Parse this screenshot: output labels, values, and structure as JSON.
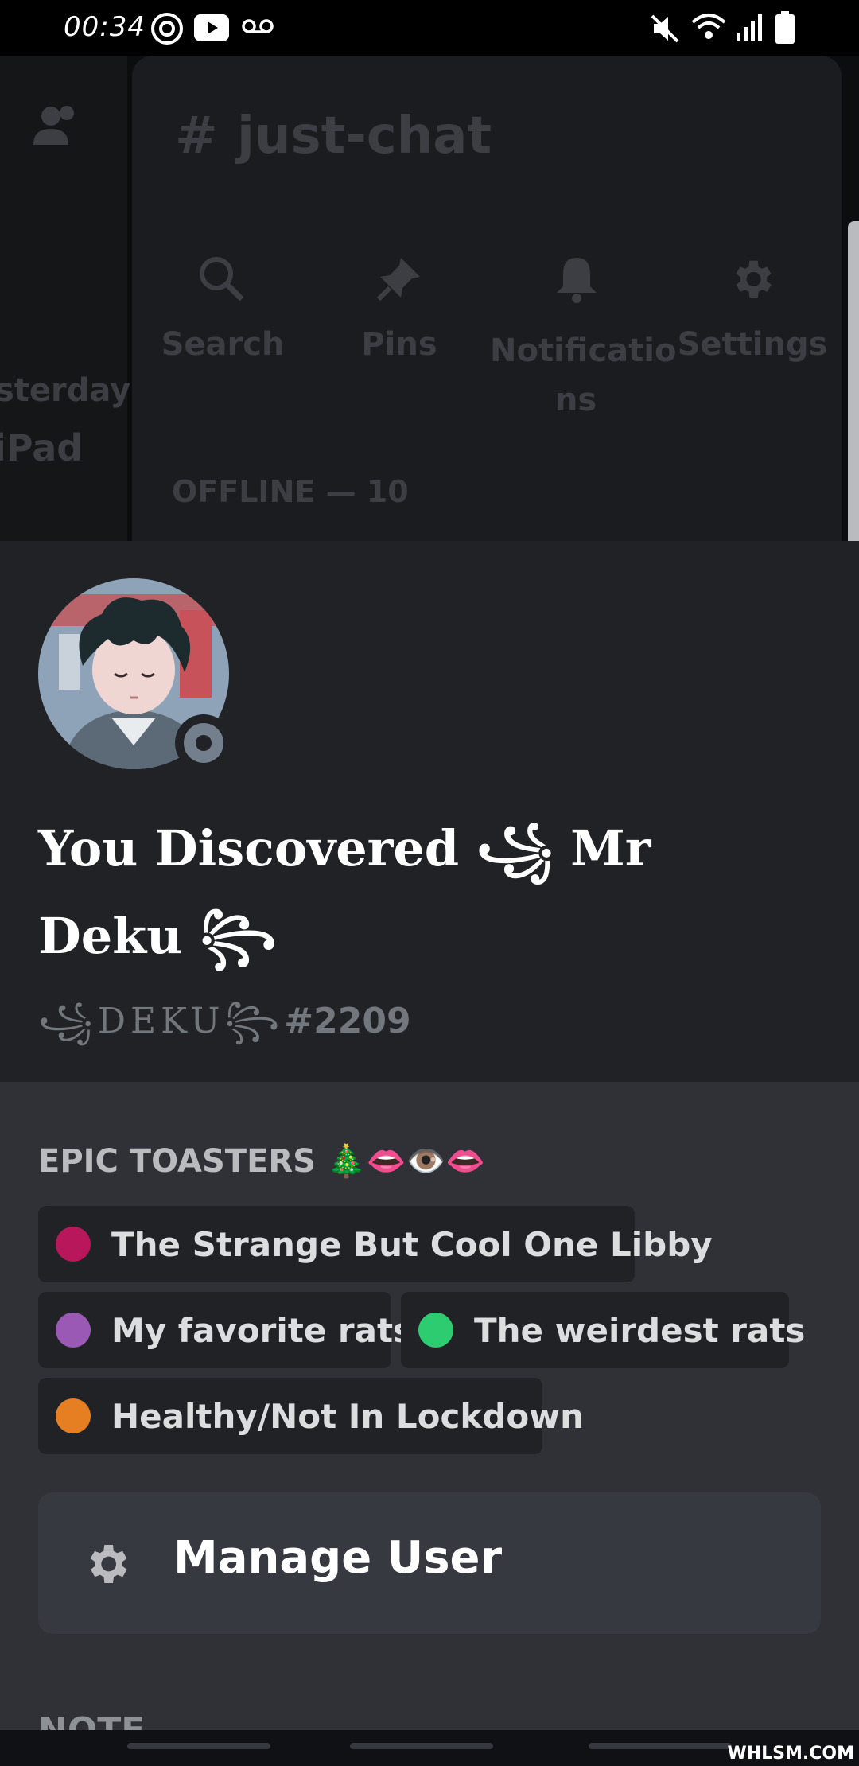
{
  "status_bar": {
    "time": "00:34",
    "icons": [
      "threads-icon",
      "youtube-icon",
      "voicemail-icon",
      "mute-icon",
      "wifi-icon",
      "signal-icon",
      "battery-icon"
    ]
  },
  "background": {
    "channel_name": "just-chat",
    "actions": [
      {
        "icon": "search-icon",
        "label": "Search"
      },
      {
        "icon": "pin-icon",
        "label": "Pins"
      },
      {
        "icon": "bell-icon",
        "label": "Notificatio\nns"
      },
      {
        "icon": "gear-icon",
        "label": "Settings"
      }
    ],
    "member_section": "OFFLINE — 10",
    "side_text_1": "sterday",
    "side_text_2": "iPad"
  },
  "profile": {
    "nickname": "You Discovered ꧁ Mr Deku ꧂",
    "username": "꧁DEKU꧂",
    "discriminator": "#2209",
    "status": "offline"
  },
  "roles_section": {
    "title": "EPIC TOASTERS 🎄👄👁️👄",
    "roles": [
      {
        "name": "The Strange But Cool One Libby",
        "color": "#b9175b"
      },
      {
        "name": "My favorite rats",
        "color": "#9b59b6"
      },
      {
        "name": "The weirdest rats",
        "color": "#2ecc71"
      },
      {
        "name": "Healthy/Not In Lockdown",
        "color": "#e67e22"
      }
    ]
  },
  "manage_user": {
    "label": "Manage User",
    "icon": "gear-icon"
  },
  "note_title": "NOTE",
  "watermark": "WHLSM.COM"
}
